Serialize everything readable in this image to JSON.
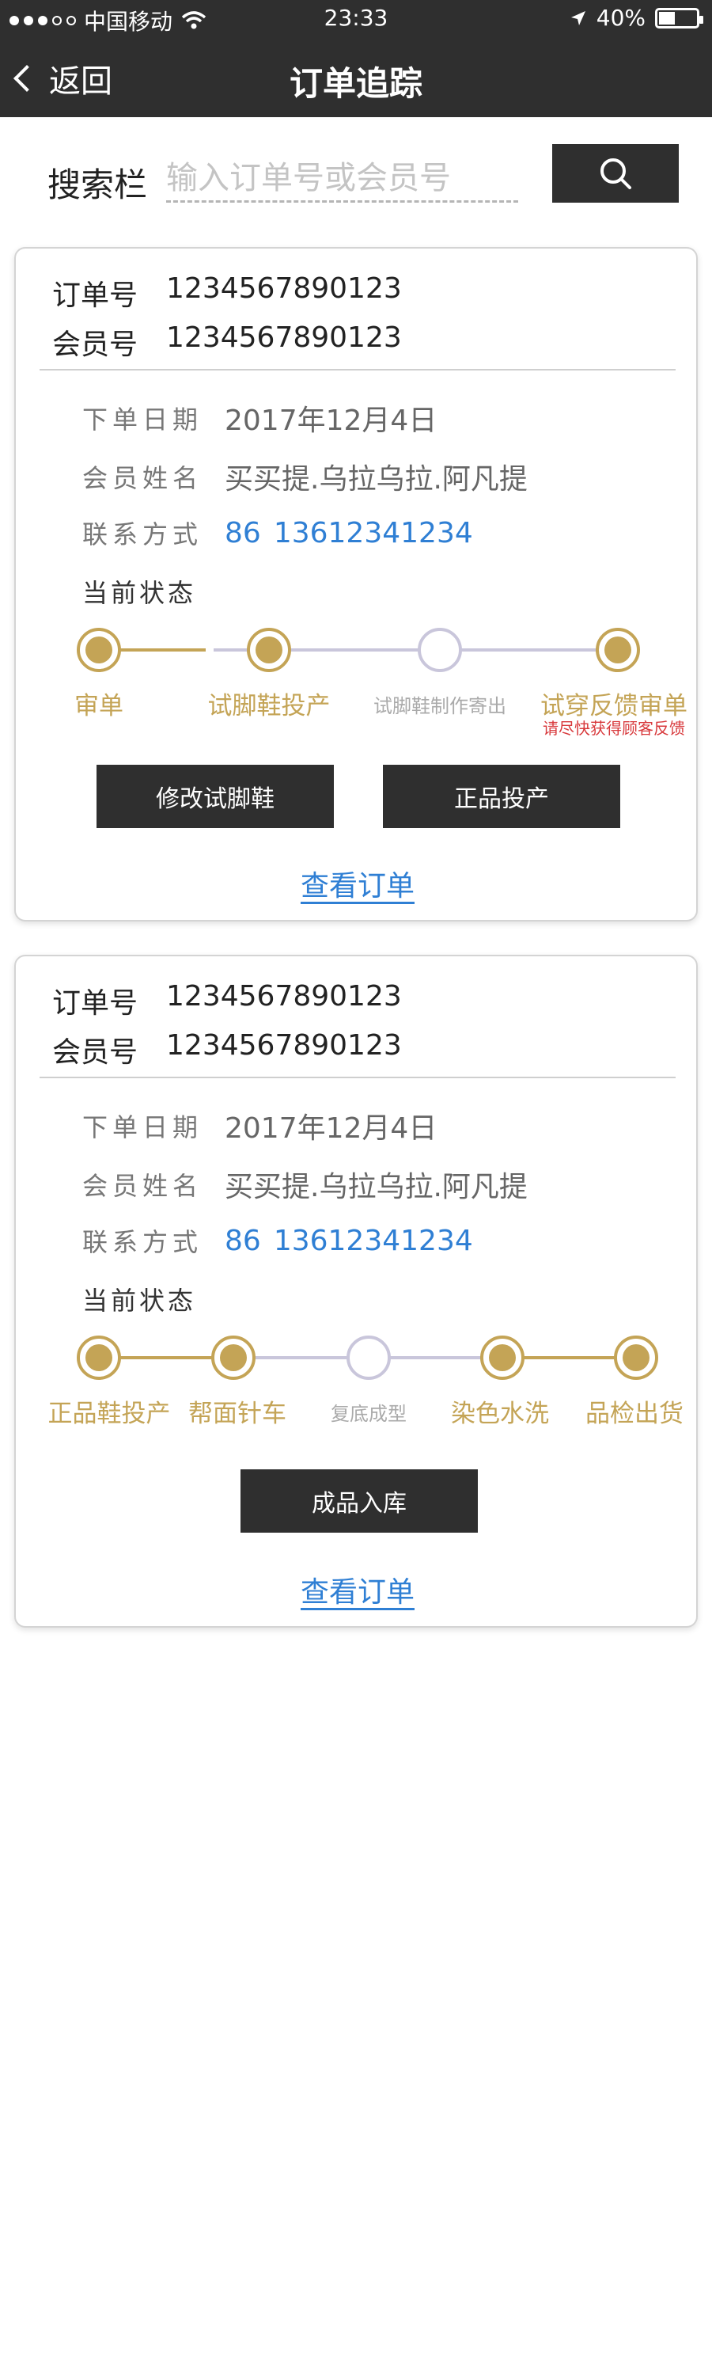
{
  "status_bar": {
    "carrier": "中国移动",
    "time": "23:33",
    "battery": "40%",
    "battery_level": 0.4
  },
  "header": {
    "back_label": "返回",
    "title": "订单追踪"
  },
  "search": {
    "label": "搜索栏",
    "placeholder": "输入订单号或会员号"
  },
  "orders": [
    {
      "order_label": "订单号",
      "order_no": "1234567890123",
      "member_label": "会员号",
      "member_no": "1234567890123",
      "date_label": "下单日期",
      "date": "2017年12月4日",
      "name_label": "会员姓名",
      "name": "买买提.乌拉乌拉.阿凡提",
      "contact_label": "联系方式",
      "country_code": "86",
      "phone": "13612341234",
      "status_label": "当前状态",
      "steps": [
        {
          "label": "审单",
          "done": true
        },
        {
          "label": "试脚鞋投产",
          "done": true
        },
        {
          "label": "试脚鞋制作寄出",
          "done": false
        },
        {
          "label": "试穿反馈审单",
          "done": true,
          "note": "请尽快获得顾客反馈"
        }
      ],
      "buttons": [
        "修改试脚鞋",
        "正品投产"
      ],
      "view_label": "查看订单"
    },
    {
      "order_label": "订单号",
      "order_no": "1234567890123",
      "member_label": "会员号",
      "member_no": "1234567890123",
      "date_label": "下单日期",
      "date": "2017年12月4日",
      "name_label": "会员姓名",
      "name": "买买提.乌拉乌拉.阿凡提",
      "contact_label": "联系方式",
      "country_code": "86",
      "phone": "13612341234",
      "status_label": "当前状态",
      "steps": [
        {
          "label": "正品鞋投产",
          "done": true
        },
        {
          "label": "帮面针车",
          "done": true
        },
        {
          "label": "复底成型",
          "done": false
        },
        {
          "label": "染色水洗",
          "done": true
        },
        {
          "label": "品检出货",
          "done": true
        }
      ],
      "buttons": [
        "成品入库"
      ],
      "view_label": "查看订单"
    }
  ],
  "colors": {
    "dark": "#2f2f2f",
    "gold": "#c4a456",
    "pending": "#c9c6db",
    "link": "#2f7fd4",
    "note": "#d8393c"
  },
  "icons": {
    "search": "search-icon",
    "back": "chevron-left-icon",
    "wifi": "wifi-icon",
    "location": "location-arrow-icon",
    "battery": "battery-icon"
  }
}
